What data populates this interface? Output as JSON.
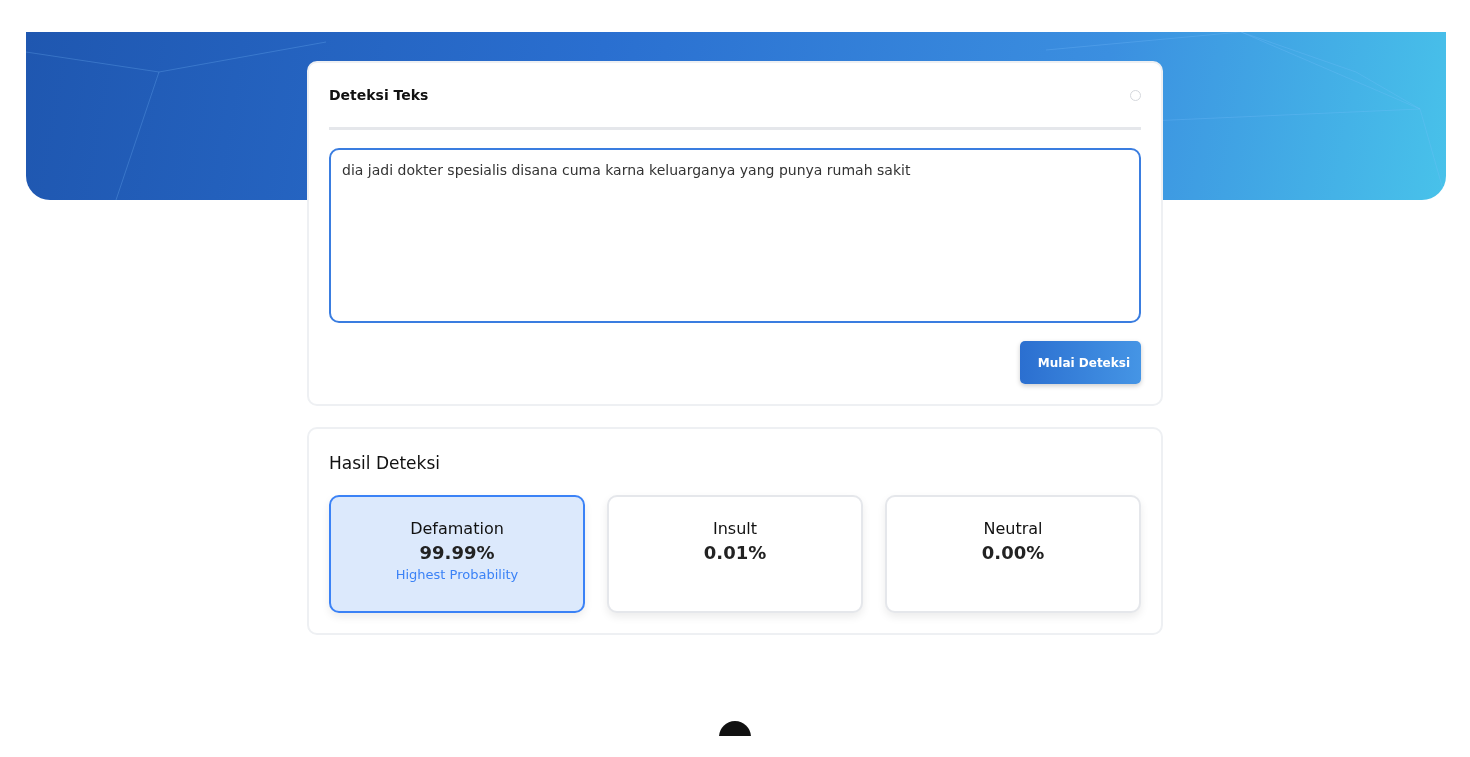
{
  "input_card": {
    "title": "Deteksi Teks",
    "text": "dia jadi dokter spesialis disana cuma karna keluarganya yang punya rumah sakit",
    "button": "Mulai Deteksi"
  },
  "results": {
    "title": "Hasil Deteksi",
    "items": [
      {
        "label": "Defamation",
        "value": "99.99%",
        "note": "Highest Probability",
        "selected": true
      },
      {
        "label": "Insult",
        "value": "0.01%",
        "selected": false
      },
      {
        "label": "Neutral",
        "value": "0.00%",
        "selected": false
      }
    ]
  }
}
